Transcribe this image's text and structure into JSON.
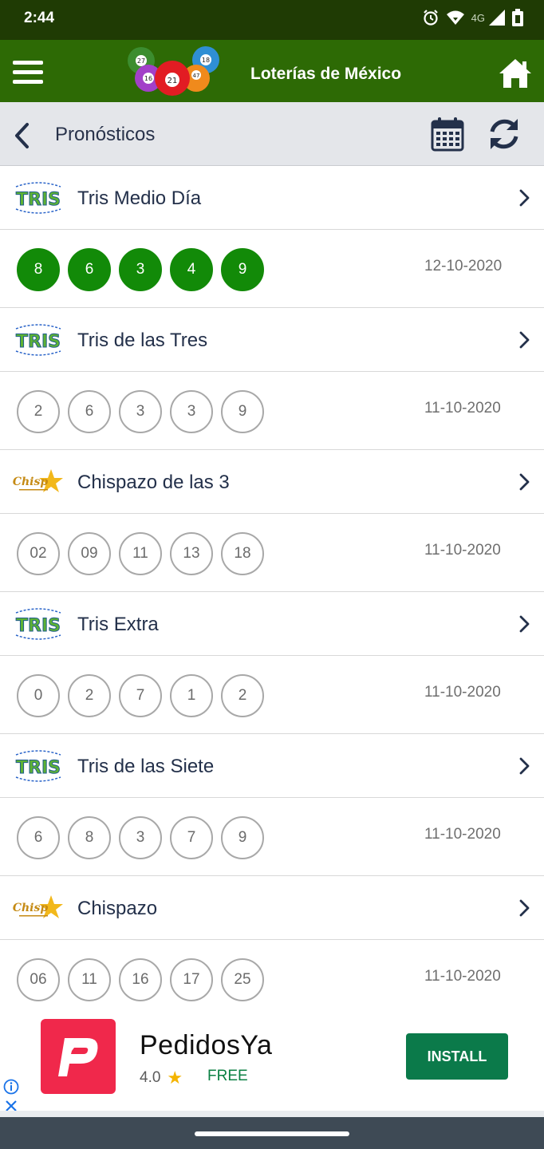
{
  "status_bar": {
    "time": "2:44",
    "network_label": "4G",
    "icons": [
      "alarm-icon",
      "wifi-icon",
      "signal-icon",
      "battery-icon"
    ]
  },
  "app_bar": {
    "title": "Loterías de México",
    "logo_balls": [
      "27",
      "18",
      "16",
      "21",
      "47"
    ],
    "icons": [
      "menu-icon",
      "home-icon"
    ],
    "color": "#2d6a05"
  },
  "sub_header": {
    "title": "Pronósticos",
    "icons": [
      "back-icon",
      "calendar-icon",
      "refresh-icon"
    ]
  },
  "games": [
    {
      "name": "Tris Medio Día",
      "logo": "TRIS",
      "numbers": [
        "8",
        "6",
        "3",
        "4",
        "9"
      ],
      "date": "12-10-2020",
      "style": "filled"
    },
    {
      "name": "Tris de las Tres",
      "logo": "TRIS",
      "numbers": [
        "2",
        "6",
        "3",
        "3",
        "9"
      ],
      "date": "11-10-2020",
      "style": "outline"
    },
    {
      "name": "Chispazo de las 3",
      "logo": "Chispazo",
      "numbers": [
        "02",
        "09",
        "11",
        "13",
        "18"
      ],
      "date": "11-10-2020",
      "style": "outline"
    },
    {
      "name": "Tris Extra",
      "logo": "TRIS",
      "numbers": [
        "0",
        "2",
        "7",
        "1",
        "2"
      ],
      "date": "11-10-2020",
      "style": "outline"
    },
    {
      "name": "Tris de las Siete",
      "logo": "TRIS",
      "numbers": [
        "6",
        "8",
        "3",
        "7",
        "9"
      ],
      "date": "11-10-2020",
      "style": "outline"
    },
    {
      "name": "Chispazo",
      "logo": "Chispazo",
      "numbers": [
        "06",
        "11",
        "16",
        "17",
        "25"
      ],
      "date": "11-10-2020",
      "style": "outline"
    }
  ],
  "ad": {
    "app_name": "PedidosYa",
    "rating": "4.0",
    "price": "FREE",
    "install_label": "INSTALL",
    "icons": [
      "pedidosya-logo-icon",
      "star-icon",
      "ad-info-icon",
      "ad-close-icon"
    ]
  },
  "colors": {
    "status_bar": "#1f3b04",
    "app_bar": "#2d6a05",
    "ball_filled": "#128a08",
    "install_button": "#0b7a4a",
    "nav_bar": "#3e4a55"
  }
}
